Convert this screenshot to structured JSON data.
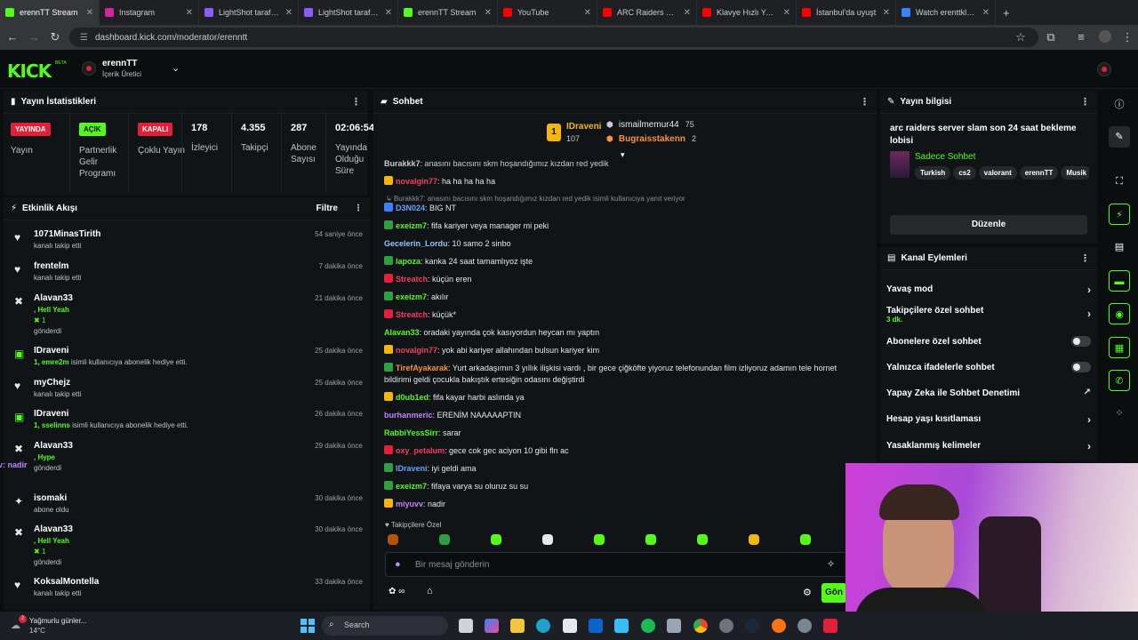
{
  "browser": {
    "tabs": [
      {
        "title": "erennTT Stream",
        "color": "#53fc18",
        "active": true
      },
      {
        "title": "Instagram",
        "color": "#d6249f"
      },
      {
        "title": "LightShot tarafından",
        "color": "#8b5cf6"
      },
      {
        "title": "LightShot tarafından",
        "color": "#8b5cf6"
      },
      {
        "title": "erennTT Stream",
        "color": "#53fc18"
      },
      {
        "title": "YouTube",
        "color": "#ff0000"
      },
      {
        "title": "ARC Raiders WTF",
        "color": "#ff0000"
      },
      {
        "title": "Klavye Hızlı Yazma",
        "color": "#ff0000"
      },
      {
        "title": "İstanbul'da uyuşt",
        "color": "#ff0000"
      },
      {
        "title": "Watch erenttklavy",
        "color": "#3b82f6"
      }
    ],
    "url": "dashboard.kick.com/moderator/erenntt"
  },
  "header": {
    "logo": "KICK",
    "beta": "BETA",
    "channel_name": "erennTT",
    "channel_role": "İçerik Üretici"
  },
  "stats": {
    "title": "Yayın İstatistikleri",
    "items": [
      {
        "badge": "YAYINDA",
        "badge_color": "#e3203a",
        "label": "Yayın"
      },
      {
        "badge": "AÇIK",
        "badge_color": "#53fc18",
        "label": "Partnerlik Gelir Programı"
      },
      {
        "badge": "KAPALI",
        "badge_color": "#e3203a",
        "label": "Çoklu Yayın"
      },
      {
        "value": "178",
        "label": "İzleyici"
      },
      {
        "value": "4.355",
        "label": "Takipçi"
      },
      {
        "value": "287",
        "label": "Abone Sayısı"
      },
      {
        "value": "02:06:54",
        "label": "Yayında Olduğu Süre"
      }
    ]
  },
  "activity": {
    "title": "Etkinlik Akışı",
    "filter": "Filtre",
    "items": [
      {
        "icon": "♥",
        "name": "1071MinasTirith",
        "sub": "kanalı takip etti",
        "time": "54 saniye önce"
      },
      {
        "icon": "♥",
        "name": "frentelm",
        "sub": "kanalı takip etti",
        "time": "7 dakika önce"
      },
      {
        "icon": "✖",
        "name": "Alavan33",
        "line2": ", Hell Yeah",
        "line3": "1",
        "sub": "gönderdi",
        "time": "21 dakika önce"
      },
      {
        "icon": "▣",
        "name": "IDraveni",
        "gift": "1, emre2m",
        "sub": " isimli kullanıcıya abonelik hediye etti.",
        "time": "25 dakika önce"
      },
      {
        "icon": "♥",
        "name": "myChejz",
        "sub": "kanalı takip etti",
        "time": "25 dakika önce"
      },
      {
        "icon": "▣",
        "name": "IDraveni",
        "gift": "1, sselinns",
        "sub": " isimli kullanıcıya abonelik hediye etti.",
        "time": "26 dakika önce"
      },
      {
        "icon": "✖",
        "name": "Alavan33",
        "line2": ", Hype",
        "overlay": "miyuvv: nadir",
        "sub": "gönderdi",
        "time": "29 dakika önce"
      },
      {
        "icon": "✦",
        "name": "isomaki",
        "sub": "abone oldu",
        "time": "30 dakika önce"
      },
      {
        "icon": "✖",
        "name": "Alavan33",
        "line2": ", Hell Yeah",
        "line3": "1",
        "sub": "gönderdi",
        "time": "30 dakika önce"
      },
      {
        "icon": "♥",
        "name": "KoksalMontella",
        "sub": "kanalı takip etti",
        "time": "33 dakika önce"
      }
    ]
  },
  "chat": {
    "title": "Sohbet",
    "top": [
      {
        "rank": "1",
        "name": "IDraveni",
        "value": "107"
      },
      {
        "name": "ismailmemur44",
        "value": "75"
      },
      {
        "name": "Bugraisstakenn",
        "value": "2"
      }
    ],
    "reply_hint": "Burakkk7: anasını bacısını skm hoşandığımız kızdan red yedik isimli kullanıcıya yanıt veriyor",
    "messages": [
      {
        "user": "Burakkk7",
        "color": "#e6e8ea",
        "badge": "",
        "text": ": anasını bacısını skm hoşandığımız kızdan red yedik"
      },
      {
        "user": "novalgin77",
        "color": "#f43f5e",
        "badge": "#f5b50a",
        "text": ": ha ha ha ha ha"
      },
      {
        "user": "D3N024",
        "color": "#60a5fa",
        "badge": "#3b82f6",
        "text": ": BIG NT"
      },
      {
        "user": "exeizm7",
        "color": "#53fc18",
        "badge": "#2ea043",
        "text": ": fifa kariyer veya manager mi peki"
      },
      {
        "user": "Gecelerin_Lordu",
        "color": "#93c5fd",
        "badge": "",
        "text": ": 10 samo 2 sinbo"
      },
      {
        "user": "lapoza",
        "color": "#53fc18",
        "badge": "#2ea043",
        "text": ": kanka 24 saat tamamlıyoz işte"
      },
      {
        "user": "Streatch",
        "color": "#f43f5e",
        "badge": "#e3203a",
        "text": ": küçün eren"
      },
      {
        "user": "exeizm7",
        "color": "#53fc18",
        "badge": "#2ea043",
        "text": ": akılır"
      },
      {
        "user": "Streatch",
        "color": "#f43f5e",
        "badge": "#e3203a",
        "text": ": küçük*"
      },
      {
        "user": "Alavan33",
        "color": "#53fc18",
        "badge": "",
        "text": ": oradaki yayında çok kasıyordun heycan mı yaptın"
      },
      {
        "user": "novalgin77",
        "color": "#f43f5e",
        "badge": "#f5b50a",
        "text": ": yok abi kariyer allahından bulsun kariyer kim"
      },
      {
        "user": "TirefAyakarak",
        "color": "#fb923c",
        "badge": "#2ea043",
        "text": ": Yurt arkadaşımın 3 yıllık ilişkisi vardı , bir gece çiğköfte yiyoruz telefonundan film izliyoruz adamın tele hornet bildirimi geldi çocukla bakıştık ertesiğin odasını değiştirdi"
      },
      {
        "user": "d0ub1ed",
        "color": "#53fc18",
        "badge": "#f5b50a",
        "text": ": fifa kayar harbi aslında ya"
      },
      {
        "user": "burhanmeric",
        "color": "#c084fc",
        "badge": "",
        "text": ": ERENİM NAAAAAPTIN"
      },
      {
        "user": "RabbiYessSirr",
        "color": "#53fc18",
        "badge": "",
        "text": ": sarar"
      },
      {
        "user": "oxy_petalum",
        "color": "#f43f5e",
        "badge": "#e3203a",
        "text": ": gece cok gec aciyon 10 gibi fln ac"
      },
      {
        "user": "IDraveni",
        "color": "#60a5fa",
        "badge": "#2ea043",
        "text": ": iyi geldi ama"
      },
      {
        "user": "exeizm7",
        "color": "#53fc18",
        "badge": "#2ea043",
        "text": ": fifaya varya su oluruz su su"
      },
      {
        "user": "miyuvv",
        "color": "#c084fc",
        "badge": "#f5b50a",
        "text": ": nadir"
      }
    ],
    "followers_only": "Takipçilere Özel",
    "input_placeholder": "Bir mesaj gönderin",
    "send_label": "Gön"
  },
  "stream_info": {
    "title": "Yayın bilgisi",
    "stream_title": "arc raiders server slam son 24 saat bekleme lobisi",
    "category": "Sadece Sohbet",
    "tags": [
      "Turkish",
      "cs2",
      "valorant",
      "erennTT",
      "Musik"
    ],
    "edit_label": "Düzenle"
  },
  "channel_actions": {
    "title": "Kanal Eylemleri",
    "items": [
      {
        "label": "Yavaş mod",
        "kind": "arrow"
      },
      {
        "label": "Takipçilere özel sohbet",
        "sub": "3 dk.",
        "kind": "arrow"
      },
      {
        "label": "Abonelere özel sohbet",
        "kind": "toggle"
      },
      {
        "label": "Yalnızca ifadelerle sohbet",
        "kind": "toggle"
      },
      {
        "label": "Yapay Zeka ile Sohbet Denetimi",
        "kind": "external"
      },
      {
        "label": "Hesap yaşı kısıtlaması",
        "kind": "arrow"
      },
      {
        "label": "Yasaklanmış kelimeler",
        "kind": "arrow"
      }
    ]
  },
  "taskbar": {
    "weather_title": "Yağmurlu günler...",
    "weather_temp": "14°C",
    "weather_badge": "2",
    "search": "Search"
  }
}
